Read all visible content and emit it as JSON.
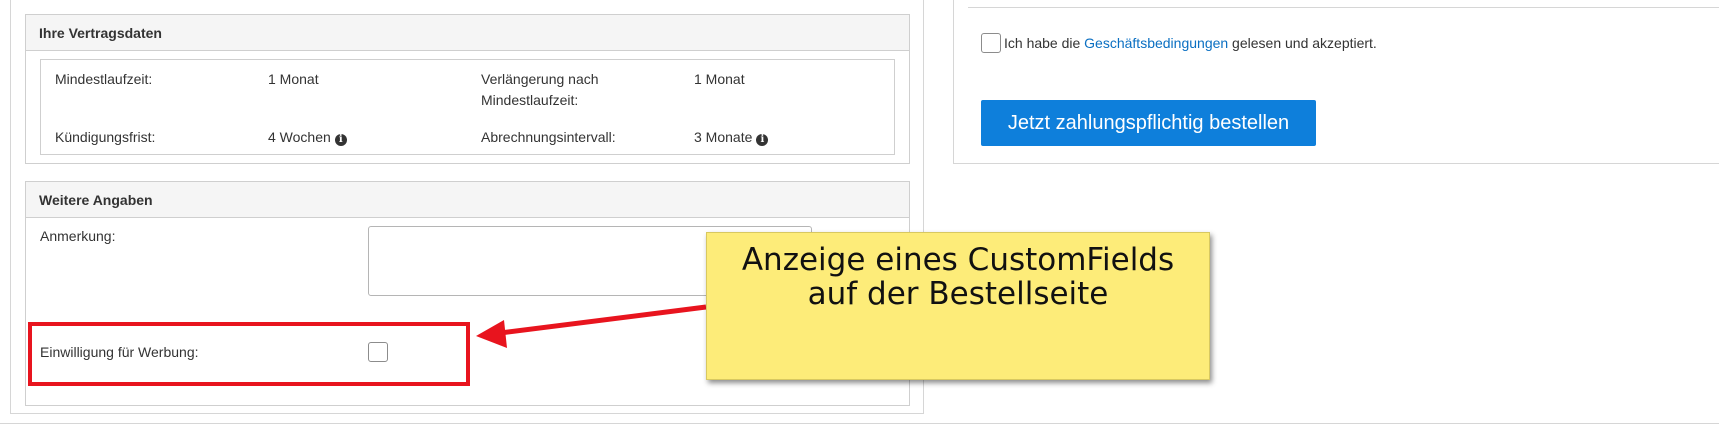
{
  "contract": {
    "title": "Ihre Vertragsdaten",
    "min_term_label": "Mindestlaufzeit:",
    "min_term_value": "1 Monat",
    "renewal_label_line1": "Verlängerung nach",
    "renewal_label_line2": "Mindestlaufzeit:",
    "renewal_value": "1 Monat",
    "notice_label": "Kündigungsfrist:",
    "notice_value": "4 Wochen",
    "billing_label": "Abrechnungsintervall:",
    "billing_value": "3 Monate",
    "info_glyph": "i"
  },
  "more": {
    "title": "Weitere Angaben",
    "remark_label": "Anmerkung:",
    "remark_value": "",
    "consent_label": "Einwilligung für Werbung:",
    "consent_checked": false
  },
  "order": {
    "terms_prefix": "Ich habe die ",
    "terms_link": "Geschäftsbedingungen",
    "terms_suffix": " gelesen und akzeptiert.",
    "terms_checked": false,
    "button_label": "Jetzt zahlungspflichtig bestellen",
    "button_color": "#0e7fdb"
  },
  "annotation": {
    "line1": "Anzeige eines CustomFields",
    "line2": "auf der Bestellseite",
    "callout_color": "#fdec79",
    "highlight_color": "#e8141e"
  }
}
